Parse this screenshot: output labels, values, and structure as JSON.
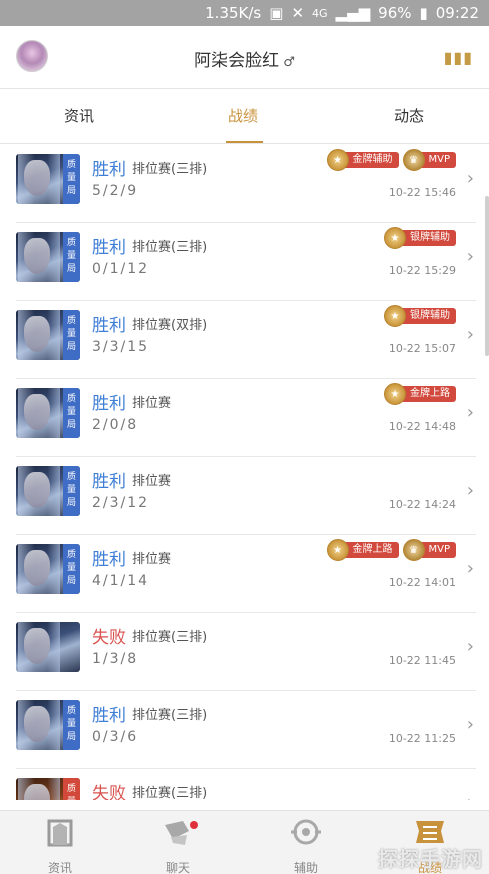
{
  "status_bar": {
    "speed": "1.35K/s",
    "network": "4G",
    "battery": "96%",
    "time": "09:22"
  },
  "header": {
    "title": "阿柒会脸红",
    "menu_icon": "menu-icon"
  },
  "tabs": [
    {
      "label": "资讯",
      "active": false
    },
    {
      "label": "战绩",
      "active": true
    },
    {
      "label": "动态",
      "active": false
    }
  ],
  "hero_tag": "质量局",
  "matches": [
    {
      "result": "胜利",
      "mode": "排位赛(三排)",
      "kda": "5/2/9",
      "time": "10-22 15:46",
      "badges": [
        "金牌辅助",
        "MVP"
      ],
      "outcome": "win"
    },
    {
      "result": "胜利",
      "mode": "排位赛(三排)",
      "kda": "0/1/12",
      "time": "10-22 15:29",
      "badges": [
        "银牌辅助"
      ],
      "outcome": "win"
    },
    {
      "result": "胜利",
      "mode": "排位赛(双排)",
      "kda": "3/3/15",
      "time": "10-22 15:07",
      "badges": [
        "银牌辅助"
      ],
      "outcome": "win"
    },
    {
      "result": "胜利",
      "mode": "排位赛",
      "kda": "2/0/8",
      "time": "10-22 14:48",
      "badges": [
        "金牌上路"
      ],
      "outcome": "win"
    },
    {
      "result": "胜利",
      "mode": "排位赛",
      "kda": "2/3/12",
      "time": "10-22 14:24",
      "badges": [],
      "outcome": "win"
    },
    {
      "result": "胜利",
      "mode": "排位赛",
      "kda": "4/1/14",
      "time": "10-22 14:01",
      "badges": [
        "金牌上路",
        "MVP"
      ],
      "outcome": "win"
    },
    {
      "result": "失败",
      "mode": "排位赛(三排)",
      "kda": "1/3/8",
      "time": "10-22 11:45",
      "badges": [],
      "outcome": "loss"
    },
    {
      "result": "胜利",
      "mode": "排位赛(三排)",
      "kda": "0/3/6",
      "time": "10-22 11:25",
      "badges": [],
      "outcome": "win"
    },
    {
      "result": "失败",
      "mode": "排位赛(三排)",
      "kda": "",
      "time": "",
      "badges": [],
      "outcome": "loss",
      "alt_hero": true
    }
  ],
  "bottom_nav": [
    {
      "label": "资讯",
      "icon": "news-icon",
      "active": false
    },
    {
      "label": "聊天",
      "icon": "chat-icon",
      "active": false,
      "notification": true
    },
    {
      "label": "辅助",
      "icon": "assist-icon",
      "active": false
    },
    {
      "label": "战绩",
      "icon": "record-icon",
      "active": true
    }
  ],
  "watermark": "探探手游网"
}
